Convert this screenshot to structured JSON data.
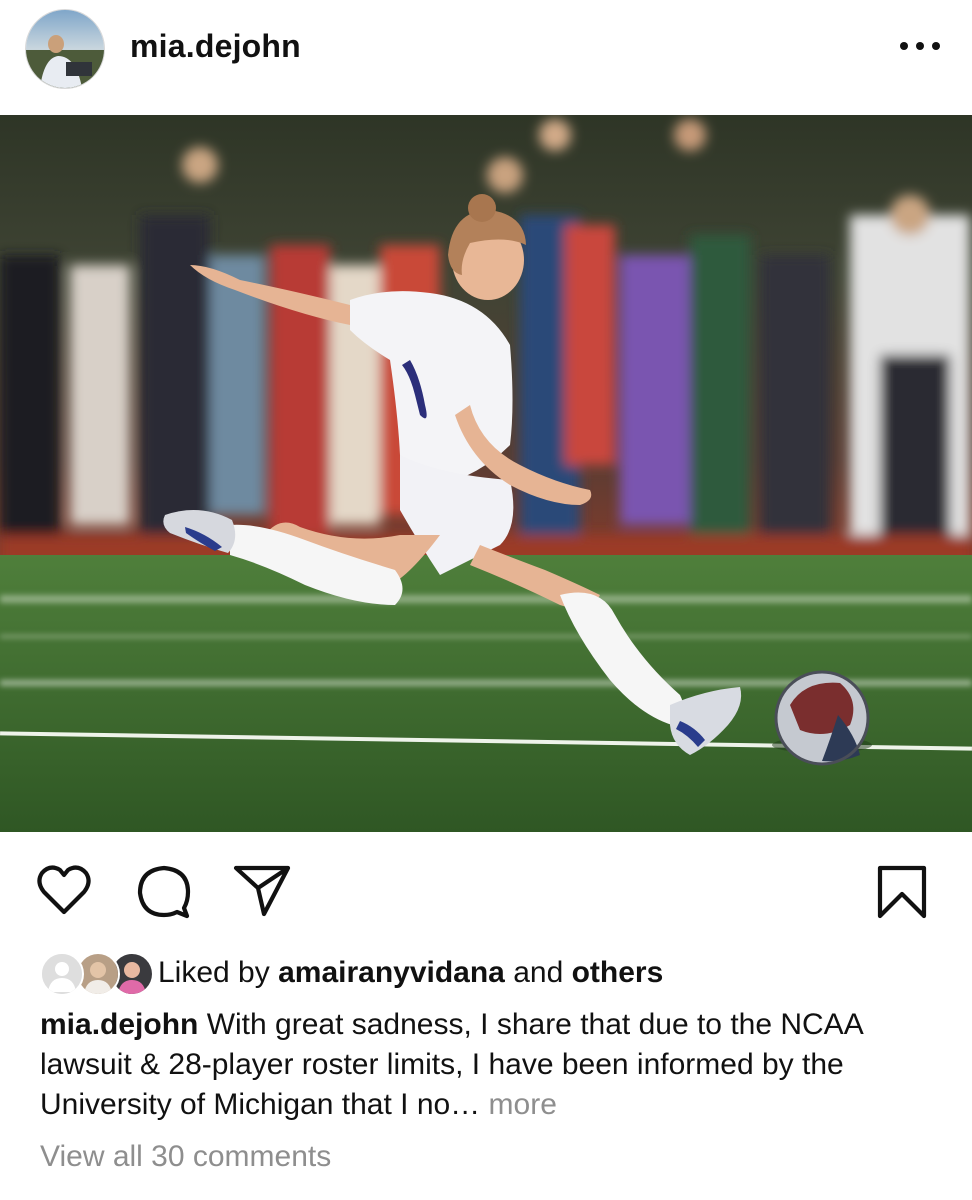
{
  "post": {
    "username": "mia.dejohn",
    "more_menu_icon": "more-horizontal-icon"
  },
  "actions": {
    "like_icon": "heart-icon",
    "comment_icon": "comment-icon",
    "share_icon": "send-icon",
    "save_icon": "bookmark-icon"
  },
  "likes": {
    "prefix": "Liked by ",
    "user": "amairanyvidana",
    "connector": " and ",
    "others": "others"
  },
  "caption": {
    "username": "mia.dejohn",
    "text": " With great sadness, I share that due to the NCAA lawsuit & 28-player roster limits, I have been informed by the University of Michigan that I no…",
    "more_label": " more"
  },
  "comments": {
    "view_all": "View all 30 comments"
  },
  "colors": {
    "text": "#111111",
    "muted": "#8e8e8e",
    "turf": "#3d6e2e",
    "track": "#a64630"
  }
}
